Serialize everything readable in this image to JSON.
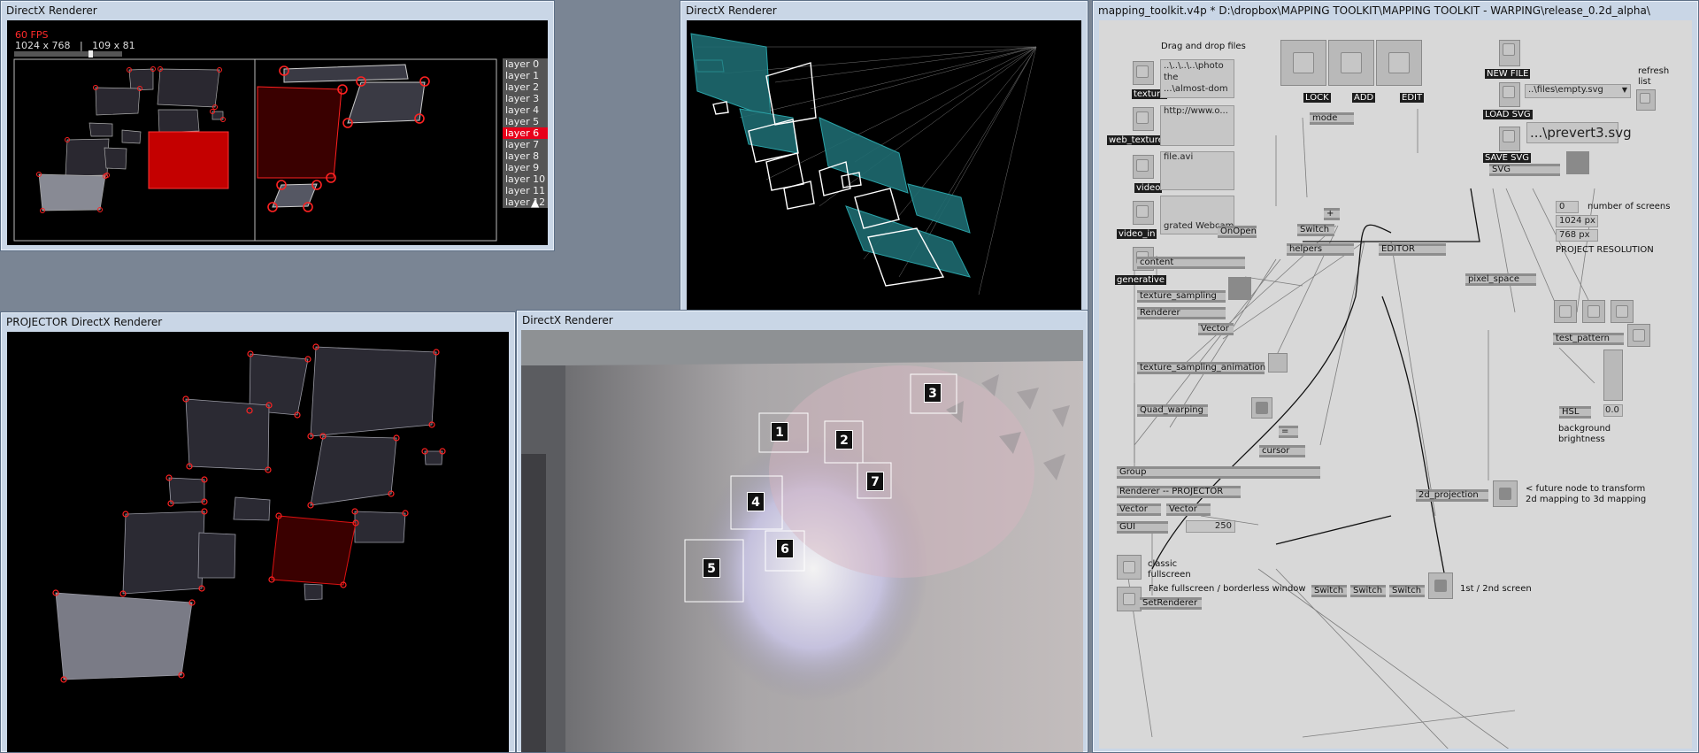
{
  "win_left": {
    "title": "DirectX Renderer",
    "fps": "60 FPS",
    "resolution": "1024 x 768   |   109 x 81",
    "layers": [
      "layer 0",
      "layer 1",
      "layer 2",
      "layer 3",
      "layer 4",
      "layer 5",
      "layer 6",
      "layer 7",
      "layer 8",
      "layer 9",
      "layer 10",
      "layer 11",
      "layer 12"
    ],
    "active_layer": "layer 6"
  },
  "win_3d": {
    "title": "DirectX Renderer"
  },
  "win_projector": {
    "title": "PROJECTOR   DirectX Renderer"
  },
  "win_camera": {
    "title": "DirectX Renderer",
    "labels": [
      "1",
      "2",
      "3",
      "4",
      "5",
      "6",
      "7"
    ]
  },
  "patch": {
    "title": "mapping_toolkit.v4p *   D:\\dropbox\\MAPPING TOOLKIT\\MAPPING TOOLKIT - WARPING\\release_0.2d_alpha\\",
    "drag_drop": "Drag and drop files",
    "file_texture": "..\\..\\..\\..\\photo",
    "file_texture2": "the",
    "file_texture3": "...\\almost-dom",
    "url": "http://www.o...",
    "file_avi": "file.avi",
    "webcam": "grated Webcam",
    "labels": {
      "texture": "texture",
      "web_texture": "web_texture",
      "video": "video",
      "video_in": "video_in",
      "generative": "generative",
      "lock": "LOCK",
      "add": "ADD",
      "edit": "EDIT",
      "new_file": "NEW FILE",
      "load_svg": "LOAD SVG",
      "save_svg": "SAVE SVG",
      "refresh": "refresh",
      "list": "list"
    },
    "files_dropdown": "..\\files\\empty.svg",
    "svg_path": "...\\prevert3.svg",
    "nodes": {
      "mode": "mode",
      "switch": "Switch",
      "helpers": "helpers",
      "editor": "EDITOR",
      "svg": "SVG",
      "onopen": "OnOpen",
      "content": "content",
      "texture_sampling": "texture_sampling",
      "renderer": "Renderer",
      "vector": "Vector",
      "pixel_space": "pixel_space",
      "texture_sampling_animation": "texture_sampling_animation",
      "quad_warping": "Quad_warping",
      "test_pattern": "test_pattern",
      "hsl": "HSL",
      "cursor": "cursor",
      "group": "Group",
      "renderer_projector": "Renderer -- PROJECTOR",
      "vector_a": "Vector",
      "vector_b": "Vector",
      "gui": "GUI",
      "projection": "2d_projection",
      "setrenderer": "SetRenderer",
      "switch1": "Switch",
      "switch2": "Switch",
      "switch3": "Switch",
      "plus": "+",
      "equals": "="
    },
    "number_of_screens_value": "0",
    "number_of_screens": "number of screens",
    "width_px": "1024 px",
    "height_px": "768 px",
    "project_resolution": "PROJECT RESOLUTION",
    "brightness_value": "0.0",
    "background_brightness_1": "background",
    "background_brightness_2": "brightness",
    "gui_value": "250",
    "future_node_1": "< future node to transform",
    "future_node_2": "2d mapping to 3d mapping",
    "classic_1": "classic",
    "classic_2": "fullscreen",
    "fake_fullscreen": "Fake fullscreen / borderless window",
    "screens_toggle": "1st / 2nd screen"
  }
}
